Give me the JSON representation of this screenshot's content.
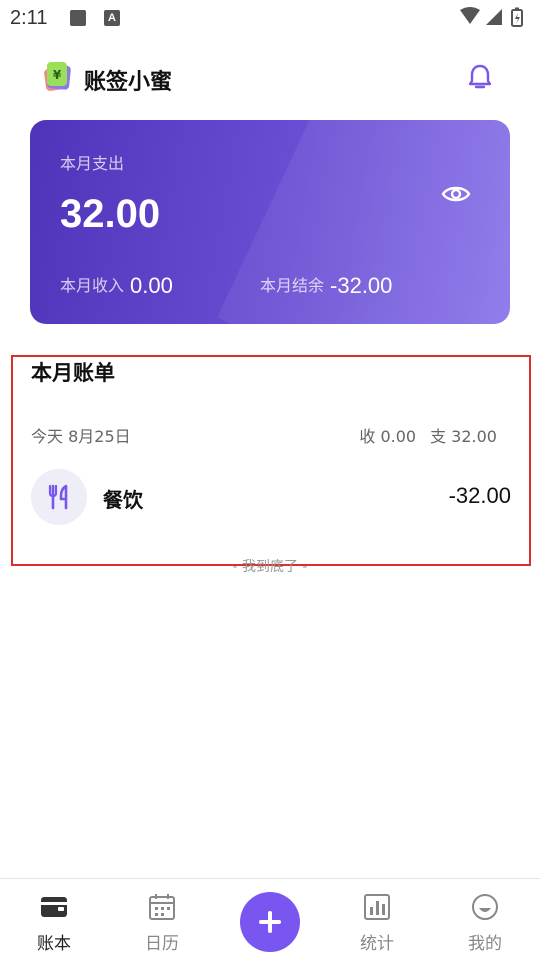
{
  "status_bar": {
    "time": "2:11",
    "notif_letter": "A"
  },
  "header": {
    "app_title": "账签小蜜",
    "logo_symbol": "¥"
  },
  "summary": {
    "expense_label": "本月支出",
    "expense_value": "32.00",
    "income_label": "本月收入",
    "income_value": "0.00",
    "balance_label": "本月结余",
    "balance_value": "-32.00"
  },
  "bills": {
    "title": "本月账单",
    "date_label": "今天 8月25日",
    "income_summary": "收 0.00",
    "expense_summary": "支 32.00",
    "items": [
      {
        "category": "餐饮",
        "amount": "-32.00",
        "icon": "fork-knife-icon"
      }
    ],
    "end_note": "- 我到底了 -"
  },
  "nav": {
    "items": [
      {
        "label": "账本",
        "icon": "wallet-icon",
        "active": true
      },
      {
        "label": "日历",
        "icon": "calendar-icon"
      },
      {
        "label": "统计",
        "icon": "chart-icon"
      },
      {
        "label": "我的",
        "icon": "profile-icon"
      }
    ],
    "add_icon": "plus-icon"
  },
  "colors": {
    "accent": "#7a56f0",
    "card_start": "#4f33b8",
    "card_end": "#8b74ea",
    "highlight_border": "#d9302c"
  }
}
